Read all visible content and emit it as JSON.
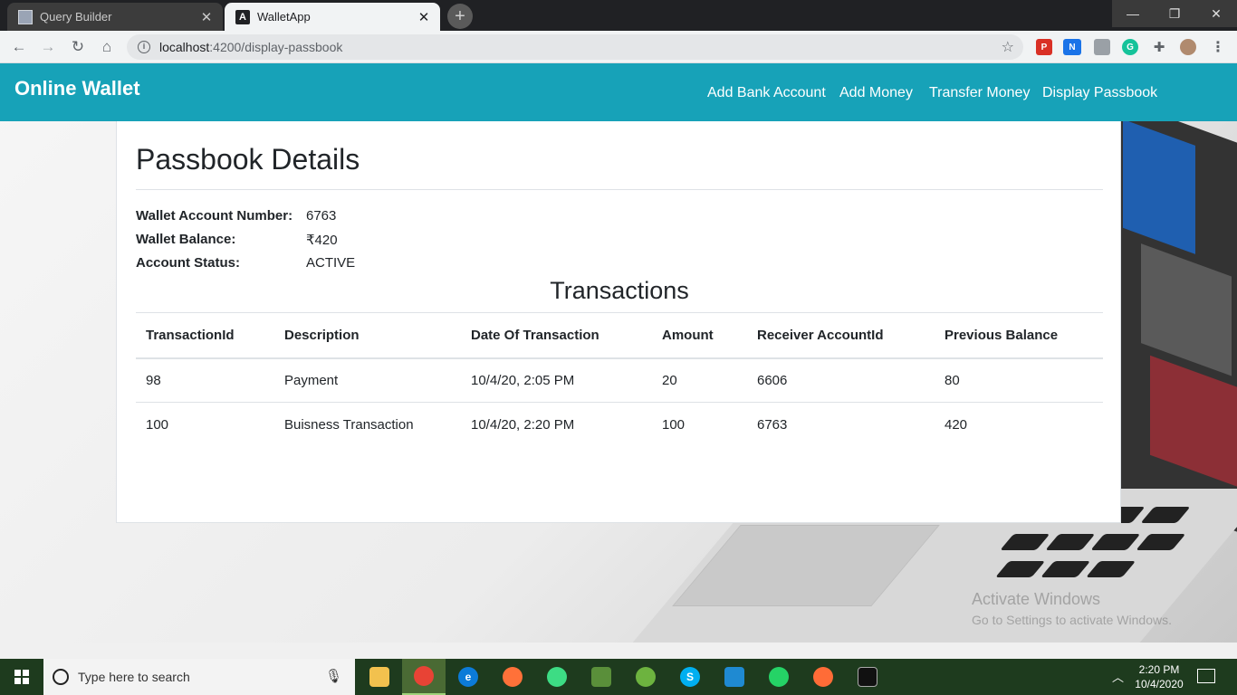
{
  "browser": {
    "tabs": [
      {
        "title": "Query Builder",
        "active": false
      },
      {
        "title": "WalletApp",
        "active": true
      }
    ],
    "url": {
      "host": "localhost",
      "rest": ":4200/display-passbook"
    },
    "window_controls": {
      "minimize": "—",
      "restore": "❐",
      "close": "✕"
    }
  },
  "navbar": {
    "brand": "Online Wallet",
    "links": [
      "Add Bank Account",
      "Add Money",
      "Transfer Money",
      "Display Passbook"
    ],
    "color": "#17a2b8"
  },
  "passbook": {
    "title": "Passbook Details",
    "account": [
      {
        "label": "Wallet Account Number:",
        "value": "6763"
      },
      {
        "label": "Wallet Balance:",
        "value": "₹420"
      },
      {
        "label": "Account Status:",
        "value": "ACTIVE"
      }
    ],
    "transactions_title": "Transactions",
    "columns": [
      "TransactionId",
      "Description",
      "Date Of Transaction",
      "Amount",
      "Receiver AccountId",
      "Previous Balance"
    ],
    "rows": [
      [
        "98",
        "Payment",
        "10/4/20, 2:05 PM",
        "20",
        "6606",
        "80"
      ],
      [
        "100",
        "Buisness Transaction",
        "10/4/20, 2:20 PM",
        "100",
        "6763",
        "420"
      ]
    ]
  },
  "watermark": {
    "line1": "Activate Windows",
    "line2": "Go to Settings to activate Windows."
  },
  "taskbar": {
    "search_placeholder": "Type here to search",
    "time": "2:20 PM",
    "date": "10/4/2020"
  }
}
